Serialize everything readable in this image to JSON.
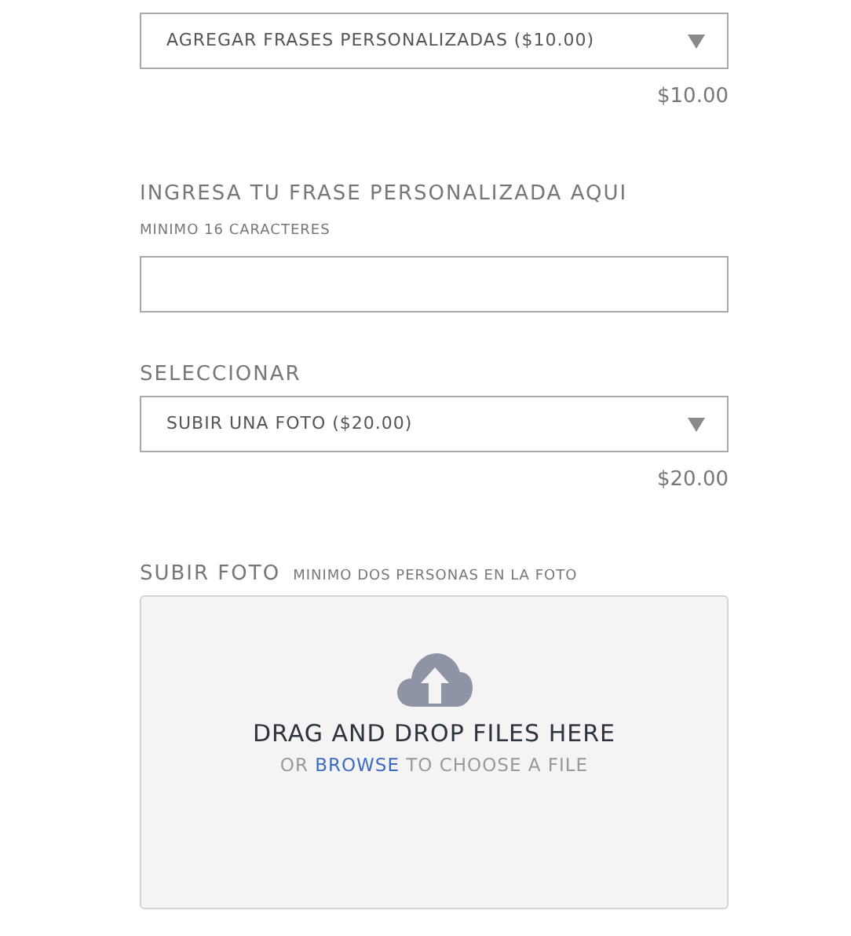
{
  "sections": [
    {
      "kind": "select",
      "value": "AGREGAR FRASES PERSONALIZADAS ($10.00)",
      "price": "$10.00"
    },
    {
      "kind": "text",
      "label": "INGRESA TU FRASE PERSONALIZADA AQUI",
      "hint": "MINIMO 16 CARACTERES"
    },
    {
      "kind": "select",
      "label": "SELECCIONAR",
      "value": "SUBIR UNA FOTO ($20.00)",
      "price": "$20.00"
    },
    {
      "kind": "upload",
      "label": "SUBIR FOTO",
      "note": "MINIMO DOS PERSONAS EN LA FOTO",
      "title": "DRAG AND DROP FILES HERE",
      "before_link": "OR",
      "link": "BROWSE",
      "after_link": "TO CHOOSE A FILE"
    }
  ]
}
